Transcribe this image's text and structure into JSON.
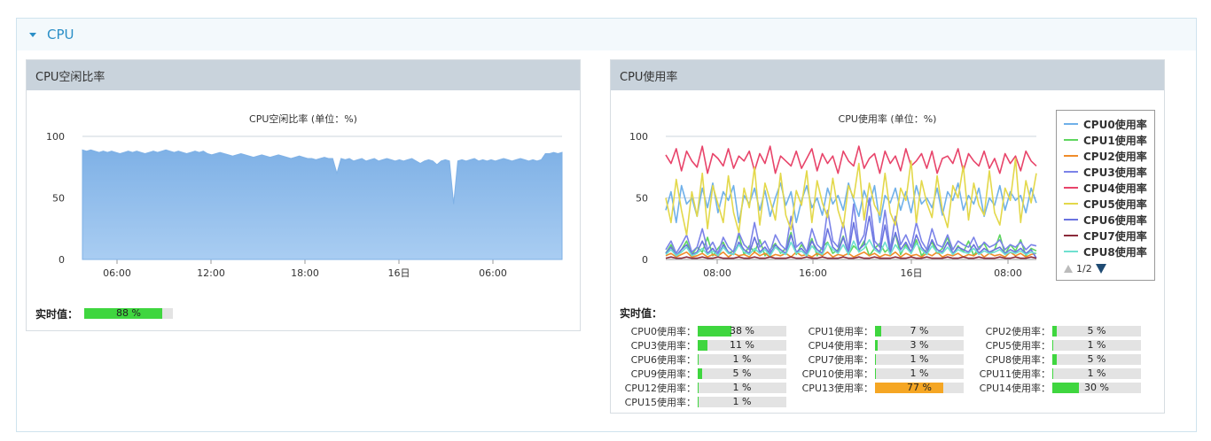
{
  "section": {
    "title": "CPU"
  },
  "idle_panel": {
    "header": "CPU空闲比率",
    "realtime_label": "实时值：",
    "realtime_value": 88,
    "realtime_text": "88 %",
    "color": "#3fd63f"
  },
  "usage_panel": {
    "header": "CPU使用率",
    "realtime_label": "实时值：",
    "pager": "1/2",
    "cpus": [
      {
        "name": "CPU0使用率：",
        "value": 38,
        "text": "38 %",
        "color": "#3fd63f"
      },
      {
        "name": "CPU1使用率：",
        "value": 7,
        "text": "7 %",
        "color": "#3fd63f"
      },
      {
        "name": "CPU2使用率：",
        "value": 5,
        "text": "5 %",
        "color": "#3fd63f"
      },
      {
        "name": "CPU3使用率：",
        "value": 11,
        "text": "11 %",
        "color": "#3fd63f"
      },
      {
        "name": "CPU4使用率：",
        "value": 3,
        "text": "3 %",
        "color": "#3fd63f"
      },
      {
        "name": "CPU5使用率：",
        "value": 1,
        "text": "1 %",
        "color": "#3fd63f"
      },
      {
        "name": "CPU6使用率：",
        "value": 1,
        "text": "1 %",
        "color": "#3fd63f"
      },
      {
        "name": "CPU7使用率：",
        "value": 1,
        "text": "1 %",
        "color": "#3fd63f"
      },
      {
        "name": "CPU8使用率：",
        "value": 5,
        "text": "5 %",
        "color": "#3fd63f"
      },
      {
        "name": "CPU9使用率：",
        "value": 5,
        "text": "5 %",
        "color": "#3fd63f"
      },
      {
        "name": "CPU10使用率：",
        "value": 1,
        "text": "1 %",
        "color": "#3fd63f"
      },
      {
        "name": "CPU11使用率：",
        "value": 1,
        "text": "1 %",
        "color": "#3fd63f"
      },
      {
        "name": "CPU12使用率：",
        "value": 1,
        "text": "1 %",
        "color": "#3fd63f"
      },
      {
        "name": "CPU13使用率：",
        "value": 77,
        "text": "77 %",
        "color": "#f5a623"
      },
      {
        "name": "CPU14使用率：",
        "value": 30,
        "text": "30 %",
        "color": "#3fd63f"
      },
      {
        "name": "CPU15使用率：",
        "value": 1,
        "text": "1 %",
        "color": "#3fd63f"
      }
    ]
  },
  "chart_data": [
    {
      "type": "area",
      "title": "CPU空闲比率 (单位：%)",
      "ylim": [
        0,
        100
      ],
      "yticks": [
        0,
        50,
        100
      ],
      "xticks": [
        "06:00",
        "12:00",
        "18:00",
        "16日",
        "06:00"
      ],
      "grid": true,
      "color": "#7fb4e6",
      "series": [
        {
          "values": [
            89,
            88,
            89,
            88,
            87,
            88,
            87,
            88,
            87,
            86,
            87,
            88,
            87,
            88,
            87,
            86,
            87,
            88,
            87,
            88,
            89,
            88,
            87,
            88,
            87,
            86,
            87,
            88,
            87,
            88,
            86,
            85,
            86,
            87,
            86,
            85,
            84,
            85,
            86,
            85,
            84,
            83,
            84,
            85,
            84,
            83,
            84,
            85,
            84,
            83,
            82,
            83,
            84,
            83,
            82,
            82,
            81,
            82,
            83,
            82,
            82,
            70,
            82,
            81,
            82,
            80,
            81,
            82,
            80,
            81,
            82,
            80,
            81,
            82,
            81,
            80,
            81,
            80,
            81,
            82,
            80,
            78,
            80,
            81,
            80,
            77,
            80,
            81,
            80,
            45,
            80,
            81,
            80,
            81,
            82,
            80,
            81,
            80,
            81,
            80,
            81,
            82,
            81,
            80,
            81,
            82,
            81,
            80,
            81,
            80,
            81,
            86,
            86,
            87,
            86,
            87
          ]
        }
      ]
    },
    {
      "type": "line",
      "title": "CPU使用率 (单位：%)",
      "ylim": [
        0,
        100
      ],
      "yticks": [
        0,
        50,
        100
      ],
      "xticks": [
        "08:00",
        "16:00",
        "16日",
        "08:00"
      ],
      "grid": true,
      "series": [
        {
          "name": "CPU0使用率",
          "color": "#6fb0e9",
          "values": [
            40,
            55,
            30,
            60,
            45,
            50,
            35,
            58,
            42,
            62,
            38,
            55,
            48,
            60,
            30,
            52,
            45,
            58,
            40,
            56,
            35,
            50,
            62,
            44,
            55,
            30,
            48,
            60,
            42,
            50,
            36,
            58,
            45,
            52,
            40,
            62,
            48,
            35,
            56,
            44,
            60,
            30,
            52,
            46,
            58,
            40,
            55,
            38,
            60,
            45,
            50,
            42,
            58,
            36,
            55,
            48,
            62,
            40,
            52,
            45,
            58,
            35,
            50,
            44,
            60,
            40,
            55,
            48,
            52,
            38,
            58,
            46
          ]
        },
        {
          "name": "CPU1使用率",
          "color": "#5fd65f",
          "values": [
            5,
            12,
            3,
            8,
            15,
            4,
            10,
            6,
            18,
            3,
            9,
            14,
            5,
            7,
            20,
            4,
            11,
            6,
            16,
            3,
            8,
            13,
            5,
            9,
            22,
            4,
            12,
            6,
            17,
            3,
            10,
            14,
            5,
            8,
            19,
            4,
            11,
            7,
            15,
            3,
            9,
            13,
            6,
            10,
            21,
            4,
            12,
            5,
            16,
            3,
            8,
            14,
            5,
            9,
            18,
            4,
            11,
            6,
            15,
            3,
            10,
            13,
            5,
            8,
            20,
            4,
            12,
            7,
            16,
            3,
            9,
            7
          ]
        },
        {
          "name": "CPU2使用率",
          "color": "#f08c2a",
          "values": [
            3,
            5,
            2,
            4,
            6,
            2,
            3,
            5,
            2,
            4,
            3,
            6,
            2,
            5,
            3,
            4,
            2,
            6,
            3,
            5,
            2,
            4,
            3,
            5,
            2,
            6,
            3,
            4,
            2,
            5,
            3,
            6,
            2,
            4,
            3,
            5,
            2,
            4,
            6,
            3,
            5,
            2,
            4,
            3,
            6,
            2,
            5,
            3,
            4,
            2,
            5,
            3,
            6,
            2,
            4,
            3,
            5,
            2,
            4,
            3,
            6,
            2,
            5,
            3,
            4,
            2,
            6,
            3,
            5,
            2,
            4,
            5
          ]
        },
        {
          "name": "CPU3使用率",
          "color": "#7b83e8",
          "values": [
            8,
            15,
            5,
            12,
            20,
            6,
            10,
            25,
            8,
            14,
            5,
            18,
            10,
            6,
            22,
            12,
            8,
            30,
            10,
            15,
            6,
            20,
            12,
            8,
            35,
            10,
            14,
            6,
            25,
            12,
            8,
            40,
            15,
            10,
            30,
            8,
            45,
            12,
            20,
            50,
            15,
            10,
            40,
            8,
            35,
            12,
            20,
            10,
            30,
            15,
            8,
            25,
            12,
            10,
            20,
            8,
            15,
            12,
            10,
            18,
            8,
            14,
            10,
            12,
            16,
            8,
            12,
            10,
            14,
            8,
            12,
            11
          ]
        },
        {
          "name": "CPU4使用率",
          "color": "#e8446a",
          "values": [
            85,
            78,
            90,
            72,
            88,
            80,
            75,
            92,
            70,
            86,
            82,
            76,
            90,
            74,
            84,
            80,
            88,
            72,
            86,
            78,
            92,
            70,
            84,
            80,
            76,
            88,
            74,
            82,
            90,
            72,
            86,
            78,
            84,
            70,
            88,
            80,
            76,
            92,
            74,
            82,
            86,
            70,
            88,
            78,
            84,
            72,
            90,
            76,
            80,
            86,
            74,
            88,
            70,
            82,
            84,
            78,
            90,
            72,
            86,
            80,
            76,
            88,
            74,
            82,
            70,
            86,
            78,
            84,
            72,
            88,
            80,
            76
          ]
        },
        {
          "name": "CPU5使用率",
          "color": "#e3d84a",
          "values": [
            50,
            30,
            65,
            40,
            20,
            55,
            35,
            70,
            25,
            60,
            45,
            30,
            68,
            38,
            22,
            58,
            42,
            75,
            28,
            62,
            48,
            32,
            70,
            36,
            24,
            56,
            44,
            72,
            30,
            64,
            46,
            34,
            66,
            40,
            26,
            60,
            50,
            78,
            32,
            62,
            44,
            36,
            70,
            38,
            28,
            58,
            48,
            80,
            30,
            64,
            46,
            34,
            68,
            40,
            26,
            60,
            50,
            76,
            32,
            62,
            44,
            36,
            72,
            38,
            28,
            58,
            48,
            82,
            30,
            64,
            46,
            70
          ]
        },
        {
          "name": "CPU6使用率",
          "color": "#6a73e0",
          "values": [
            5,
            10,
            3,
            8,
            12,
            4,
            6,
            15,
            5,
            9,
            3,
            12,
            6,
            4,
            14,
            8,
            5,
            18,
            6,
            10,
            4,
            12,
            8,
            5,
            20,
            6,
            9,
            4,
            15,
            8,
            5,
            25,
            10,
            6,
            18,
            5,
            30,
            8,
            12,
            35,
            10,
            6,
            28,
            5,
            22,
            8,
            14,
            6,
            20,
            10,
            5,
            16,
            8,
            6,
            14,
            5,
            10,
            8,
            6,
            12,
            5,
            9,
            6,
            8,
            10,
            5,
            8,
            6,
            9,
            5,
            8,
            1
          ]
        },
        {
          "name": "CPU7使用率",
          "color": "#8b2a3a",
          "values": [
            1,
            2,
            1,
            1,
            2,
            1,
            1,
            2,
            1,
            1,
            2,
            1,
            1,
            1,
            2,
            1,
            1,
            2,
            1,
            1,
            2,
            1,
            1,
            1,
            2,
            1,
            1,
            2,
            1,
            1,
            2,
            1,
            1,
            1,
            2,
            1,
            1,
            2,
            1,
            1,
            2,
            1,
            1,
            1,
            2,
            1,
            1,
            2,
            1,
            1,
            2,
            1,
            1,
            1,
            2,
            1,
            1,
            2,
            1,
            1,
            2,
            1,
            1,
            1,
            2,
            1,
            1,
            2,
            1,
            1,
            2,
            1
          ]
        },
        {
          "name": "CPU8使用率",
          "color": "#6fe0d0",
          "values": [
            4,
            8,
            3,
            6,
            10,
            3,
            5,
            9,
            4,
            7,
            3,
            10,
            5,
            4,
            12,
            6,
            4,
            9,
            5,
            8,
            3,
            10,
            6,
            4,
            14,
            5,
            7,
            3,
            11,
            6,
            4,
            13,
            8,
            5,
            12,
            4,
            15,
            6,
            9,
            16,
            8,
            5,
            14,
            4,
            12,
            6,
            10,
            5,
            13,
            8,
            4,
            11,
            6,
            5,
            10,
            4,
            8,
            6,
            5,
            9,
            4,
            7,
            5,
            6,
            8,
            4,
            6,
            5,
            7,
            4,
            6,
            5
          ]
        }
      ]
    }
  ]
}
